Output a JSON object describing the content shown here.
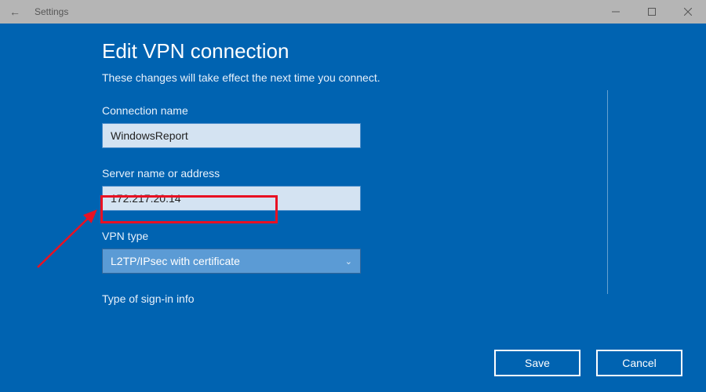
{
  "window": {
    "title": "Settings"
  },
  "dialog": {
    "heading": "Edit VPN connection",
    "subtitle": "These changes will take effect the next time you connect.",
    "fields": {
      "connection_name": {
        "label": "Connection name",
        "value": "WindowsReport"
      },
      "server": {
        "label": "Server name or address",
        "value": "172.217.20.14"
      },
      "vpn_type": {
        "label": "VPN type",
        "selected": "L2TP/IPsec with certificate"
      },
      "signin_type": {
        "label": "Type of sign-in info"
      }
    },
    "buttons": {
      "save": "Save",
      "cancel": "Cancel"
    }
  }
}
